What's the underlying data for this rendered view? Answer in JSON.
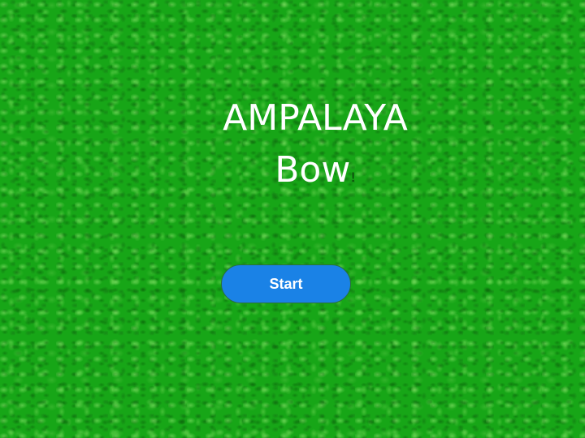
{
  "title": {
    "line1": "AMPALAYA",
    "line2_main": "Bow",
    "line2_suffix": "!"
  },
  "start_button": {
    "label": "Start"
  },
  "colors": {
    "background": "#17a617",
    "title_text": "#ffffff",
    "button_fill": "#1a82e6",
    "button_text": "#ffffff"
  }
}
